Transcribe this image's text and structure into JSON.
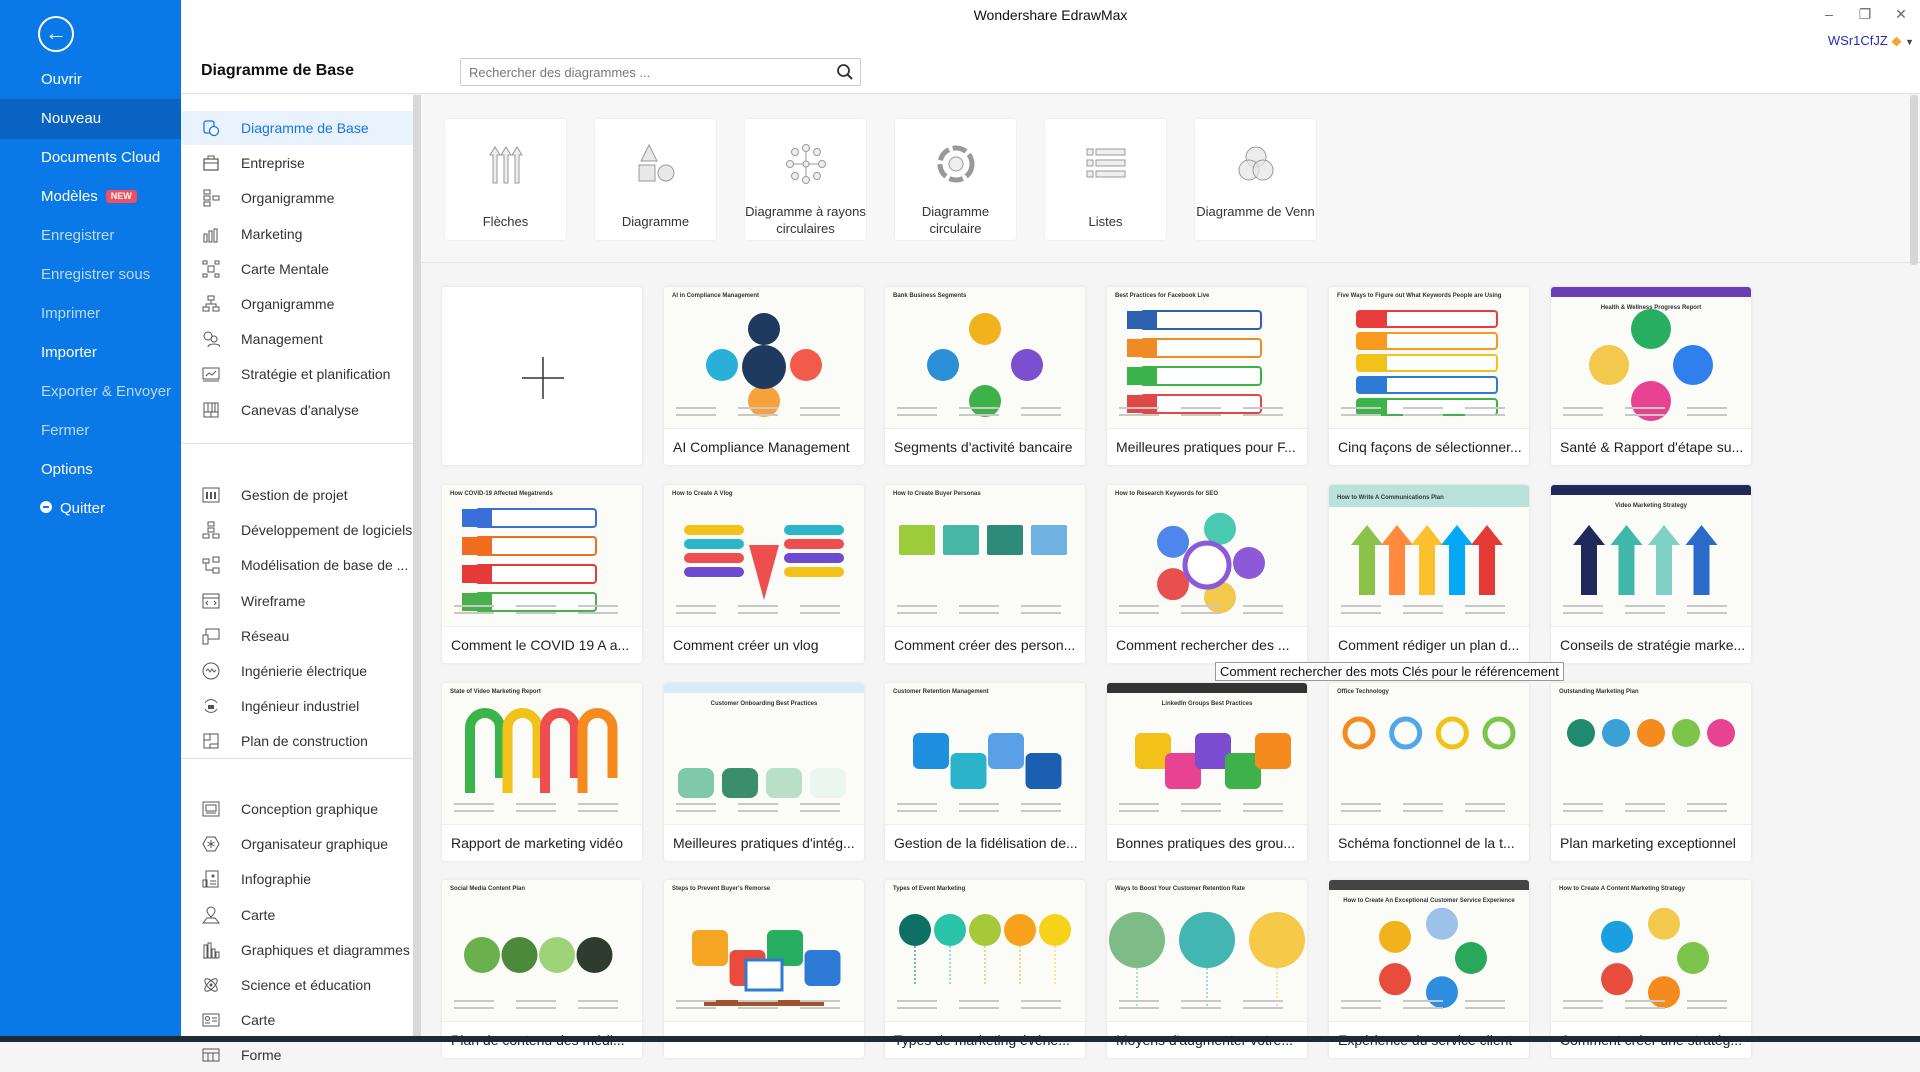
{
  "app_title": "Wondershare EdrawMax",
  "window_controls": {
    "minimize": "–",
    "restore": "❐",
    "close": "✕"
  },
  "user": {
    "name": "WSr1CfJZ",
    "icon": "diamond-icon"
  },
  "colors": {
    "nav_bg": "#0a78e6",
    "nav_active": "#0863c2",
    "accent": "#1a73e8",
    "badge": "#ef4f5f"
  },
  "leftnav": {
    "back_icon": "arrow-left-circle-icon",
    "items": [
      {
        "label": "Ouvrir",
        "state": "normal"
      },
      {
        "label": "Nouveau",
        "state": "active"
      },
      {
        "label": "Documents Cloud",
        "state": "normal"
      },
      {
        "label": "Modèles",
        "state": "normal",
        "badge": "NEW"
      },
      {
        "label": "Enregistrer",
        "state": "disabled"
      },
      {
        "label": "Enregistrer sous",
        "state": "disabled"
      },
      {
        "label": "Imprimer",
        "state": "disabled"
      },
      {
        "label": "Importer",
        "state": "normal"
      },
      {
        "label": "Exporter & Envoyer",
        "state": "disabled"
      },
      {
        "label": "Fermer",
        "state": "disabled"
      },
      {
        "label": "Options",
        "state": "normal"
      },
      {
        "label": "Quitter",
        "state": "normal",
        "icon": "minus-circle-icon"
      }
    ]
  },
  "header": {
    "title": "Diagramme de Base",
    "search_placeholder": "Rechercher des diagrammes ...",
    "search_value": ""
  },
  "categories": {
    "groups": [
      [
        {
          "label": "Diagramme de Base",
          "icon": "basic-shapes-icon",
          "active": true
        },
        {
          "label": "Entreprise",
          "icon": "briefcase-icon"
        },
        {
          "label": "Organigramme",
          "icon": "flowchart-icon"
        },
        {
          "label": "Marketing",
          "icon": "bar-chart-icon"
        },
        {
          "label": "Carte Mentale",
          "icon": "mind-map-icon"
        },
        {
          "label": "Organigramme",
          "icon": "org-chart-icon"
        },
        {
          "label": "Management",
          "icon": "people-gear-icon"
        },
        {
          "label": "Stratégie et planification",
          "icon": "monitor-chart-icon"
        },
        {
          "label": "Canevas d'analyse",
          "icon": "grid-canvas-icon"
        }
      ],
      [
        {
          "label": "Gestion de projet",
          "icon": "gantt-icon"
        },
        {
          "label": "Développement de logiciels",
          "icon": "hierarchy-icon"
        },
        {
          "label": "Modélisation de base de ...",
          "icon": "database-model-icon"
        },
        {
          "label": "Wireframe",
          "icon": "code-window-icon"
        },
        {
          "label": "Réseau",
          "icon": "network-devices-icon"
        },
        {
          "label": "Ingénierie électrique",
          "icon": "wave-circle-icon"
        },
        {
          "label": "Ingénieur industriel",
          "icon": "factory-cycle-icon"
        },
        {
          "label": "Plan de construction",
          "icon": "floor-plan-icon"
        }
      ],
      [
        {
          "label": "Conception graphique",
          "icon": "image-frame-icon"
        },
        {
          "label": "Organisateur graphique",
          "icon": "hexagon-star-icon"
        },
        {
          "label": "Infographie",
          "icon": "infographic-icon"
        },
        {
          "label": "Carte",
          "icon": "map-pin-icon"
        },
        {
          "label": "Graphiques et diagrammes",
          "icon": "column-chart-icon"
        },
        {
          "label": "Science et éducation",
          "icon": "atom-icon"
        },
        {
          "label": "Carte",
          "icon": "id-card-icon"
        },
        {
          "label": "Forme",
          "icon": "form-icon"
        }
      ]
    ]
  },
  "tiles": [
    {
      "label": "Flèches",
      "icon": "arrows-icon"
    },
    {
      "label": "Diagramme",
      "icon": "shapes-icon"
    },
    {
      "label": "Diagramme à rayons circulaires",
      "icon": "radial-icon"
    },
    {
      "label": "Diagramme circulaire",
      "icon": "cycle-icon"
    },
    {
      "label": "Listes",
      "icon": "list-icon"
    },
    {
      "label": "Diagramme de Venn",
      "icon": "venn-icon"
    }
  ],
  "new_blank": {
    "icon": "plus-icon"
  },
  "templates": [
    {
      "title": "AI Compliance Management",
      "thumb_title": "AI in Compliance Management",
      "palette": [
        "#f25a4a",
        "#f7a23b",
        "#29b0d8",
        "#1e3a5f"
      ],
      "style": "radial"
    },
    {
      "title": "Segments d'activité bancaire",
      "thumb_title": "Bank Business Segments",
      "palette": [
        "#7a4fd0",
        "#3fb14a",
        "#2a8fd6",
        "#f2b21b"
      ],
      "style": "cycle"
    },
    {
      "title": "Meilleures pratiques pour F...",
      "thumb_title": "Best Practices for Facebook Live",
      "palette": [
        "#2f5fb0",
        "#f08a24",
        "#3bb34a",
        "#e04848"
      ],
      "style": "list"
    },
    {
      "title": "Cinq façons de sélectionner...",
      "thumb_title": "Five Ways to Figure out What Keywords People are Using",
      "palette": [
        "#e93d3d",
        "#f79a1e",
        "#f2c21b",
        "#2d7bd6",
        "#3cb44b"
      ],
      "style": "bars"
    },
    {
      "title": "Santé & Rapport d'étape su...",
      "thumb_title": "Health & Wellness Progress Report",
      "palette": [
        "#2f80ed",
        "#e84393",
        "#f2c94c",
        "#27ae60"
      ],
      "style": "blobs",
      "band": "#6a3fb5"
    },
    {
      "title": "Comment le COVID 19 A a...",
      "thumb_title": "How COVID-19 Affected Megatrends",
      "palette": [
        "#3b6fd8",
        "#f06d1f",
        "#e63939",
        "#47b04b"
      ],
      "style": "list"
    },
    {
      "title": "Comment créer un vlog",
      "thumb_title": "How to Create A Vlog",
      "palette": [
        "#f2c21b",
        "#2ab5c9",
        "#ef4e4e",
        "#6c4bd1"
      ],
      "style": "funnel"
    },
    {
      "title": "Comment créer des person...",
      "thumb_title": "How to Create Buyer Personas",
      "palette": [
        "#9ccc3a",
        "#47b7a7",
        "#2e8b7a",
        "#6fb1e0"
      ],
      "style": "chevrons"
    },
    {
      "title": "Comment rechercher des ...",
      "thumb_title": "How to Research Keywords for SEO",
      "palette": [
        "#8c5ad8",
        "#f2c94c",
        "#e85050",
        "#4f86ec",
        "#48c9b0"
      ],
      "style": "bulb"
    },
    {
      "title": "Comment rédiger un plan d...",
      "thumb_title": "How to Write A Communications Plan",
      "palette": [
        "#8bc34a",
        "#ff8a3d",
        "#fbc02d",
        "#03a9f4",
        "#e53935"
      ],
      "style": "arrows",
      "band": "#b9e3d8"
    },
    {
      "title": "Conseils de stratégie marke...",
      "thumb_title": "Video Marketing Strategy",
      "palette": [
        "#1f2a5a",
        "#3fb8a9",
        "#7fd1c4",
        "#2a6ac8"
      ],
      "style": "arrows2",
      "band": "#1f2a5a"
    },
    {
      "title": "Rapport de marketing vidéo",
      "thumb_title": "State of Video Marketing Report",
      "palette": [
        "#3bb54a",
        "#f2c21b",
        "#ef4e4e",
        "#f58a1f"
      ],
      "style": "hooks"
    },
    {
      "title": "Meilleures pratiques d'intég...",
      "thumb_title": "Customer Onboarding Best Practices",
      "palette": [
        "#7fc8a9",
        "#3a8f6a",
        "#b8e0c8",
        "#eaf5f0"
      ],
      "style": "steps",
      "band": "#d7ecf7"
    },
    {
      "title": "Gestion de la fidélisation de...",
      "thumb_title": "Customer Retention Management",
      "palette": [
        "#1f8fe0",
        "#2ab3c9",
        "#5aa0e8",
        "#1a5fb0"
      ],
      "style": "boat"
    },
    {
      "title": "Bonnes pratiques des grou...",
      "thumb_title": "LinkedIn Groups Best Practices",
      "palette": [
        "#f2c21b",
        "#e84393",
        "#7c4dd1",
        "#3fb14a",
        "#f58a1f"
      ],
      "style": "puzzle",
      "band": "#333333"
    },
    {
      "title": "Schéma fonctionnel de la t...",
      "thumb_title": "Office Technology",
      "palette": [
        "#f58a1f",
        "#4fa8e8",
        "#f2c21b",
        "#7cc44a"
      ],
      "style": "rings"
    },
    {
      "title": "Plan marketing exceptionnel",
      "thumb_title": "Outstanding Marketing Plan",
      "palette": [
        "#1e8a6e",
        "#3aa0d8",
        "#f58a1f",
        "#7cc44a",
        "#e84393"
      ],
      "style": "dots"
    },
    {
      "title": "Plan de contenu des médi...",
      "thumb_title": "Social Media Content Plan",
      "palette": [
        "#6ab04c",
        "#4a8a3a",
        "#9fd37a",
        "#2f3b2f"
      ],
      "style": "road"
    },
    {
      "title": "",
      "thumb_title": "Steps to Prevent Buyer's Remorse",
      "palette": [
        "#f5a623",
        "#e74c3c",
        "#27ae60",
        "#2d7bd6"
      ],
      "style": "desk"
    },
    {
      "title": "Types de marketing événe...",
      "thumb_title": "Types of Event Marketing",
      "palette": [
        "#0e6f63",
        "#2bc3a8",
        "#a6c93a",
        "#f7a21b",
        "#f7d21b"
      ],
      "style": "balloons5"
    },
    {
      "title": "Moyens d'augmenter votre...",
      "thumb_title": "Ways to Boost Your Customer Retention Rate",
      "palette": [
        "#7dbb87",
        "#43b6b2",
        "#f7c948"
      ],
      "style": "balloons3"
    },
    {
      "title": "Expérience du service client",
      "thumb_title": "How to Create An Exceptional Customer Service Experience",
      "palette": [
        "#2aa85a",
        "#2d8ee0",
        "#e84c3d",
        "#f2b21b",
        "#9cc2ea"
      ],
      "style": "cycle2",
      "band": "#444444"
    },
    {
      "title": "Comment créer une stratég...",
      "thumb_title": "How to Create A Content Marketing Strategy",
      "palette": [
        "#7cc44a",
        "#f58a1f",
        "#e84c3d",
        "#1a9fe0",
        "#f2c94c"
      ],
      "style": "flower"
    }
  ],
  "tooltip": "Comment rechercher des mots Clés pour le référencement"
}
